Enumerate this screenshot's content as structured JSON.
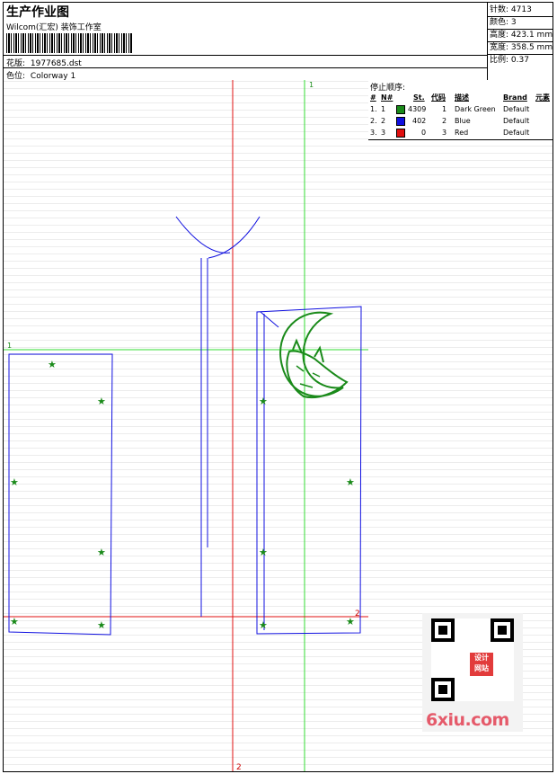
{
  "header": {
    "title": "生产作业图",
    "subtitle": "Wilcom(汇宏) 装饰工作室",
    "design_label": "花版:",
    "design_value": "1977685.dst",
    "colorway_label": "色位:",
    "colorway_value": "Colorway 1"
  },
  "stats": [
    {
      "label": "针数:",
      "value": "4713"
    },
    {
      "label": "颜色:",
      "value": "3"
    },
    {
      "label": "高度:",
      "value": "423.1 mm"
    },
    {
      "label": "宽度:",
      "value": "358.5 mm"
    },
    {
      "label": "比例:",
      "value": "0.37"
    }
  ],
  "stop_sequence": {
    "title": "停止顺序:",
    "columns": [
      "#",
      "N#",
      "St.",
      "代码",
      "描述",
      "Brand",
      "元素"
    ],
    "rows": [
      {
        "idx": "1.",
        "n": "1",
        "color": "#1a8a1a",
        "stitches": "4309",
        "code": "1",
        "desc": "Dark Green",
        "brand": "Default"
      },
      {
        "idx": "2.",
        "n": "2",
        "color": "#1010e0",
        "stitches": "402",
        "code": "2",
        "desc": "Blue",
        "brand": "Default"
      },
      {
        "idx": "3.",
        "n": "3",
        "color": "#e01010",
        "stitches": "0",
        "code": "3",
        "desc": "Red",
        "brand": "Default"
      }
    ]
  },
  "canvas": {
    "guide_labels": {
      "green_top": "1",
      "green_left": "1",
      "red_bottom": "2",
      "red_right": "2"
    }
  },
  "watermark": {
    "seal_text": "设计 网站",
    "site": "6xiu.com"
  },
  "colors": {
    "dark_green": "#1a8a1a",
    "blue": "#1010e0",
    "red": "#e01010",
    "guide_green": "#33dd33"
  }
}
